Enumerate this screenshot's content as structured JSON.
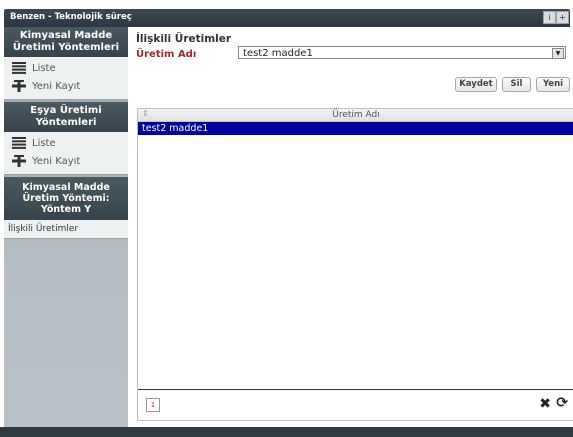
{
  "window": {
    "title": "Benzen - Teknolojik süreç",
    "info_icon": "i",
    "help_icon": "+"
  },
  "sidebar": {
    "sections": [
      {
        "title": "Kimyasal Madde Üretimi Yöntemleri",
        "links": [
          "Liste",
          "Yeni Kayıt"
        ]
      },
      {
        "title": "Eşya Üretimi Yöntemleri",
        "links": [
          "Liste",
          "Yeni Kayıt"
        ]
      }
    ],
    "current": {
      "title": "Kimyasal Madde Üretim Yöntemi: Yöntem Y",
      "link": "İlişkili Üretimler"
    }
  },
  "main": {
    "title": "İlişkili Üretimler",
    "field_label": "Üretim Adı",
    "select_value": "test2 madde1",
    "buttons": {
      "save": "Kaydet",
      "delete": "Sil",
      "new": "Yeni"
    },
    "grid": {
      "column": "Üretim Adı",
      "rows": [
        "test2 madde1"
      ],
      "page": "1"
    }
  }
}
